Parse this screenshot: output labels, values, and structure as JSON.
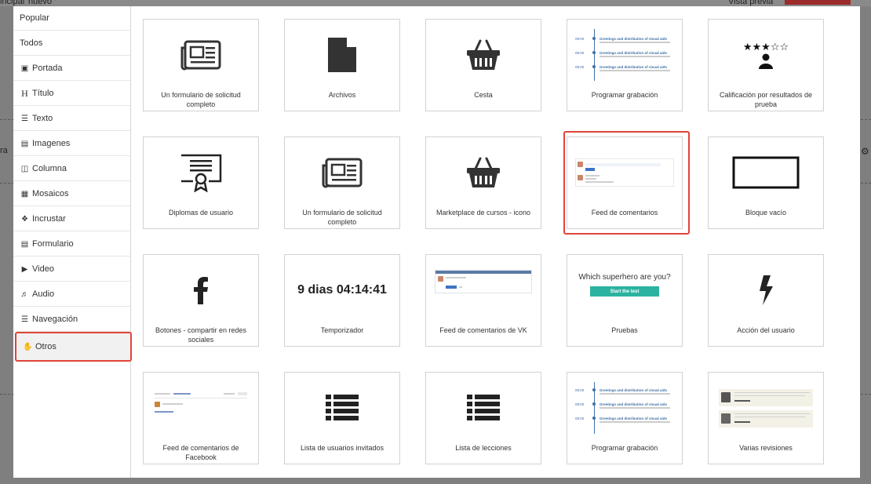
{
  "background": {
    "left_text": "incipal",
    "new_text": "nuevo",
    "right_text": "Vista previa",
    "left_mid_text": "ra",
    "accent_red": "#9c2b2b"
  },
  "sidebar": {
    "items": [
      {
        "label": "Popular",
        "icon": ""
      },
      {
        "label": "Todos",
        "icon": ""
      },
      {
        "label": "Portada",
        "icon": "image-icon"
      },
      {
        "label": "Título",
        "icon": "heading-icon"
      },
      {
        "label": "Texto",
        "icon": "text-icon"
      },
      {
        "label": "Imagenes",
        "icon": "picture-icon"
      },
      {
        "label": "Columna",
        "icon": "columns-icon"
      },
      {
        "label": "Mosaicos",
        "icon": "tiles-icon"
      },
      {
        "label": "Incrustar",
        "icon": "embed-icon"
      },
      {
        "label": "Formulario",
        "icon": "form-icon"
      },
      {
        "label": "Video",
        "icon": "video-icon"
      },
      {
        "label": "Audio",
        "icon": "audio-icon"
      },
      {
        "label": "Navegación",
        "icon": "menu-icon"
      },
      {
        "label": "Otros",
        "icon": "hand-icon",
        "selected": true
      }
    ]
  },
  "cards": [
    {
      "label": "Un formulario de solicitud completo",
      "icon": "newspaper-icon"
    },
    {
      "label": "Archivos",
      "icon": "file-icon"
    },
    {
      "label": "Cesta",
      "icon": "basket-icon"
    },
    {
      "label": "Programar grabación",
      "icon": "timeline-preview"
    },
    {
      "label": "Calificación por resultados de prueba",
      "icon": "rating-user-icon"
    },
    {
      "label": "Diplomas de usuario",
      "icon": "certificate-icon"
    },
    {
      "label": "Un formulario de solicitud completo",
      "icon": "newspaper-icon"
    },
    {
      "label": "Marketplace de cursos - icono",
      "icon": "basket-icon"
    },
    {
      "label": "Feed de comentarios",
      "icon": "comments-preview",
      "highlighted": true
    },
    {
      "label": "Bloque vacío",
      "icon": "empty-block-icon"
    },
    {
      "label": "Botones - compartir en redes sociales",
      "icon": "facebook-icon"
    },
    {
      "label": "Temporizador",
      "icon": "timer-text"
    },
    {
      "label": "Feed de comentarios de VK",
      "icon": "vk-preview"
    },
    {
      "label": "Pruebas",
      "icon": "quiz-preview"
    },
    {
      "label": "Acción del usuario",
      "icon": "bolt-icon"
    },
    {
      "label": "Feed de comentarios de Facebook",
      "icon": "facebook-comments-preview"
    },
    {
      "label": "Lista de usuarios invitados",
      "icon": "list-icon"
    },
    {
      "label": "Lista de lecciones",
      "icon": "list-icon"
    },
    {
      "label": "Programar grabación",
      "icon": "timeline-preview"
    },
    {
      "label": "Varias revisiones",
      "icon": "reviews-preview"
    }
  ],
  "previews": {
    "timer_text": "9 dias 04:14:41",
    "quiz_title": "Which superhero are you?",
    "quiz_button": "Start the test",
    "quiz_button_color": "#2bb3a0",
    "timeline": {
      "time": "09:00",
      "title": "Greetings and distribution of visual aids"
    }
  },
  "colors": {
    "highlight": "#e0443a",
    "icon_dark": "#333333",
    "link_blue": "#3f6fa8"
  }
}
